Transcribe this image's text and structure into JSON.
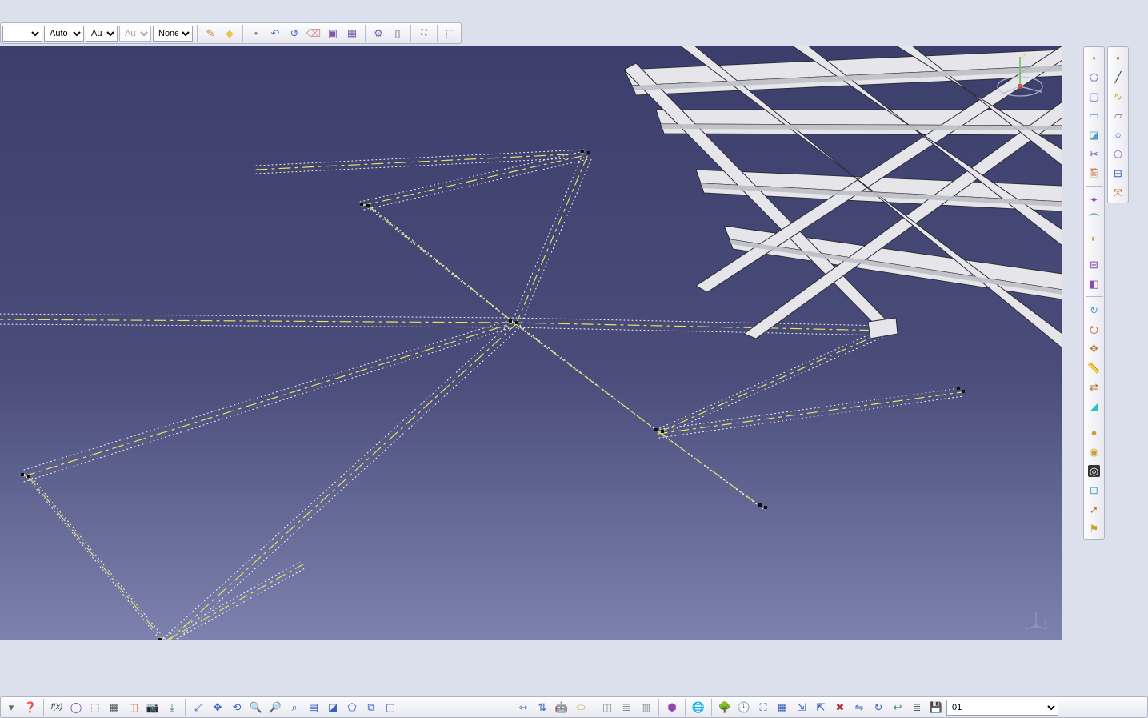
{
  "top_selects": {
    "sel1": "",
    "sel2": "Auto",
    "sel3": "Aut",
    "sel4": "Aut",
    "sel5": "None"
  },
  "top_icons_a": [
    "brush-icon",
    "diamond-icon"
  ],
  "top_icons_b": [
    "arc-icon",
    "repeat-arc-icon",
    "eraser-icon",
    "box-a-icon",
    "box-b-icon"
  ],
  "top_icons_c": [
    "gear-icon",
    "wall-icon"
  ],
  "top_icons_d": [
    "xyz-icon"
  ],
  "top_icons_e": [
    "cubes-icon"
  ],
  "right_a": [
    "point-icon",
    "shape-icon",
    "box-icon",
    "slab-icon",
    "plate-icon",
    "cut-icon",
    "link-icon"
  ],
  "right_b": [
    "cluster-icon",
    "arc-merge-icon",
    "hemisphere-icon"
  ],
  "right_c": [
    "lock-icon",
    "face-icon"
  ],
  "right_d": [
    "orbit-icon",
    "rotate-icon",
    "pan-icon",
    "ruler-icon",
    "convert-icon",
    "cyan-icon"
  ],
  "right_e": [
    "sphere-a-icon",
    "sphere-b-icon",
    "target-icon",
    "grid-search-icon",
    "arrow-icon",
    "flag-icon"
  ],
  "right_f": [
    "line-icon",
    "sketch-icon",
    "plane-icon",
    "circle-icon",
    "polygon-icon",
    "hatch-icon",
    "axis-icon"
  ],
  "bottom_a": [
    "dropdown-icon",
    "help-icon"
  ],
  "bottom_b": [
    "fx-icon",
    "loop-icon",
    "ghost-icon",
    "grid-icon",
    "cube-icon",
    "camera-icon",
    "save-arrow-icon"
  ],
  "bottom_c": [
    "fit-icon",
    "move-icon",
    "orbit-icon",
    "zoom-in-icon",
    "zoom-out-icon",
    "zoom-area-icon",
    "views-icon",
    "iso-icon",
    "iso2-icon",
    "capture-icon",
    "window-icon"
  ],
  "bottom_d": [
    "align-h-icon",
    "align-v-icon",
    "robot-icon",
    "pill-icon"
  ],
  "bottom_e": [
    "transparent-icon",
    "layers-icon",
    "panel-icon"
  ],
  "bottom_f": [
    "mode-icon"
  ],
  "bottom_g": [
    "globe-icon"
  ],
  "bottom_h": [
    "tree-icon",
    "clock-icon",
    "axis-on-icon",
    "grid-on-icon",
    "explode-icon",
    "collapse-icon",
    "delete-icon",
    "mirror-icon",
    "rotate-b-icon",
    "undo-arrow-icon",
    "list-icon",
    "disk-icon"
  ],
  "scale_input": "01"
}
